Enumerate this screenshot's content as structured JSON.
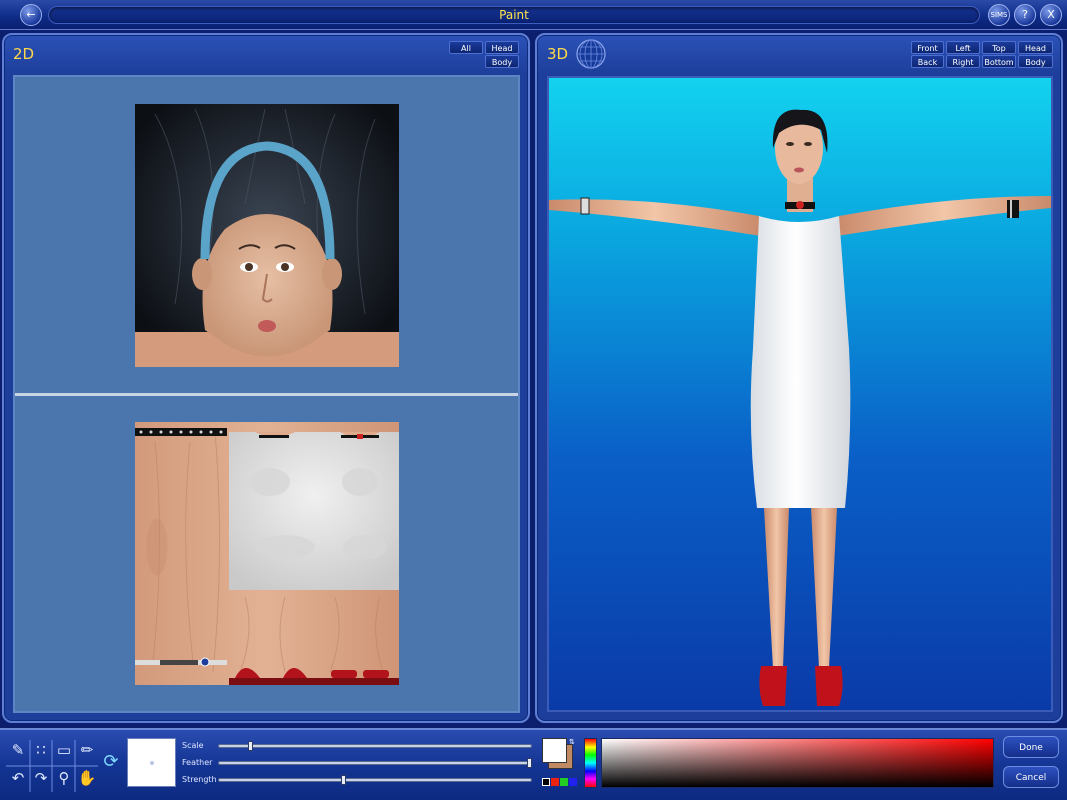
{
  "window": {
    "title": "Paint",
    "back_icon": "back-arrow-icon",
    "sims_button": "SIMS",
    "help_button": "?",
    "close_button": "X"
  },
  "panel2d": {
    "label": "2D",
    "buttons": {
      "all": "All",
      "head": "Head",
      "body": "Body"
    }
  },
  "panel3d": {
    "label": "3D",
    "globe_icon": "wireframe-globe-icon",
    "buttons": {
      "front": "Front",
      "left": "Left",
      "top": "Top",
      "head": "Head",
      "back": "Back",
      "right": "Right",
      "bottom": "Bottom",
      "body": "Body"
    }
  },
  "toolbar": {
    "tools": [
      "pencil-icon",
      "spray-icon",
      "eraser-icon",
      "eyedropper-icon",
      "undo-icon",
      "redo-icon",
      "magnify-icon",
      "hand-icon",
      "rotate-icon"
    ],
    "sliders": [
      {
        "label": "Scale",
        "value": 0.1
      },
      {
        "label": "Feather",
        "value": 1.0
      },
      {
        "label": "Strength",
        "value": 0.4
      }
    ],
    "done_label": "Done",
    "cancel_label": "Cancel"
  },
  "colors": {
    "accent": "#ffd94a",
    "primary_swatch": "#ffffff",
    "secondary_swatch": "#c08a64"
  }
}
